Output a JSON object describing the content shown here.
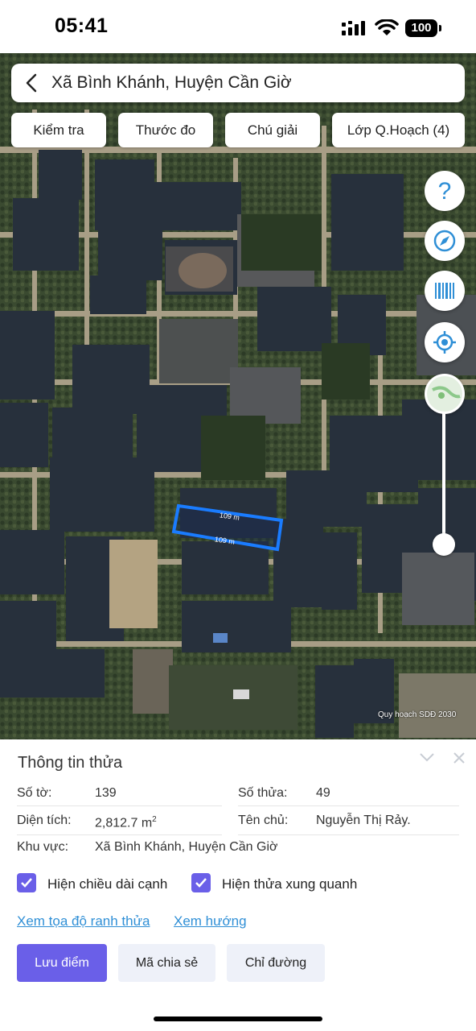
{
  "status": {
    "time": "05:41",
    "battery": "100"
  },
  "search": {
    "title": "Xã Bình Khánh, Huyện Cần Giờ"
  },
  "chips": [
    "Kiểm tra",
    "Thước đo",
    "Chú giải",
    "Lớp Q.Hoạch (4)"
  ],
  "map": {
    "parcel_top_label": "109 m",
    "parcel_bottom_label": "109 m",
    "watermark": "Quy hoạch SDĐ 2030",
    "parcel_color": "#1a7cff",
    "fab_icons": [
      "question-icon",
      "compass-icon",
      "barcode-icon",
      "locate-icon",
      "map-layer-icon"
    ]
  },
  "panel": {
    "title": "Thông tin thửa",
    "so_to_label": "Số tờ:",
    "so_to_value": "139",
    "so_thua_label": "Số thửa:",
    "so_thua_value": "49",
    "dien_tich_label": "Diện tích:",
    "dien_tich_value": "2,812.7 m",
    "dien_tich_unit_sup": "2",
    "ten_chu_label": "Tên chủ:",
    "ten_chu_value": "Nguyễn Thị Rảy.",
    "khu_vuc_label": "Khu vực:",
    "khu_vuc_value": "Xã Bình Khánh, Huyện Cần Giờ",
    "checkbox_edge_length": "Hiện chiều dài cạnh",
    "checkbox_surrounding": "Hiện thửa xung quanh",
    "link_coords": "Xem tọa độ ranh thửa",
    "link_direction": "Xem hướng",
    "btn_save": "Lưu điểm",
    "btn_share": "Mã chia sẻ",
    "btn_directions": "Chỉ đường",
    "accent_color": "#6a5fe8",
    "link_color": "#2f8fd6"
  }
}
